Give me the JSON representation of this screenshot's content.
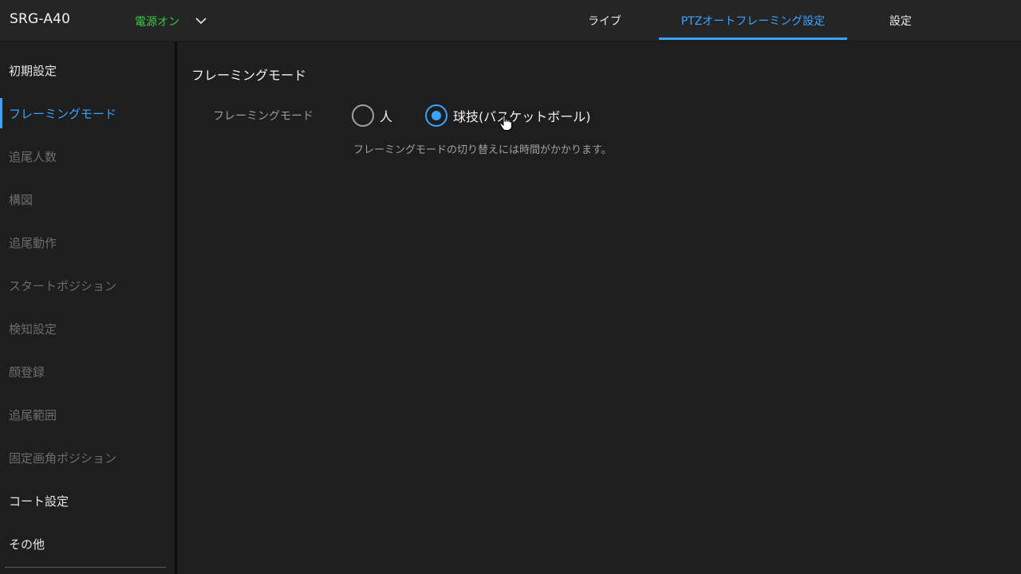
{
  "header": {
    "device_name": "SRG-A40",
    "power_status": "電源オン",
    "tabs": [
      {
        "label": "ライブ",
        "active": false
      },
      {
        "label": "PTZオートフレーミング設定",
        "active": true
      },
      {
        "label": "設定",
        "active": false
      }
    ]
  },
  "sidebar": {
    "items": [
      {
        "label": "初期設定",
        "state": "normal"
      },
      {
        "label": "フレーミングモード",
        "state": "active"
      },
      {
        "label": "追尾人数",
        "state": "disabled"
      },
      {
        "label": "構図",
        "state": "disabled"
      },
      {
        "label": "追尾動作",
        "state": "disabled"
      },
      {
        "label": "スタートポジション",
        "state": "disabled"
      },
      {
        "label": "検知設定",
        "state": "disabled"
      },
      {
        "label": "顔登録",
        "state": "disabled"
      },
      {
        "label": "追尾範囲",
        "state": "disabled"
      },
      {
        "label": "固定画角ポジション",
        "state": "disabled"
      },
      {
        "label": "コート設定",
        "state": "normal"
      },
      {
        "label": "その他",
        "state": "normal"
      }
    ]
  },
  "main": {
    "section_title": "フレーミングモード",
    "field_label": "フレーミングモード",
    "options": [
      {
        "label": "人",
        "checked": false
      },
      {
        "label": "球技(バスケットボール)",
        "checked": true
      }
    ],
    "hint": "フレーミングモードの切り替えには時間がかかります。"
  },
  "colors": {
    "accent": "#3aa3ff",
    "power_on": "#2ecc40",
    "background": "#1e1e1e",
    "header_bg": "#252525",
    "disabled_text": "#6c6c6c"
  },
  "icons": {
    "power_dropdown": "chevron-down-icon",
    "cursor": "hand-pointer-icon"
  }
}
